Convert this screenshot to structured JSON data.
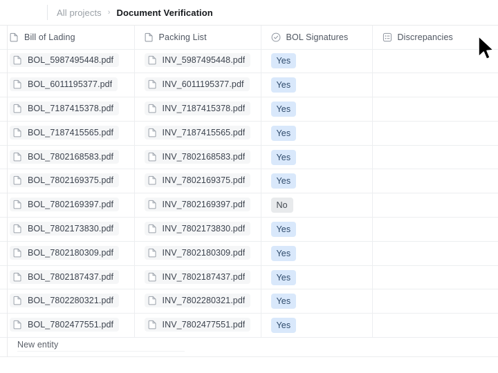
{
  "breadcrumb": {
    "root_label": "All projects",
    "separator": "›",
    "current_label": "Document Verification"
  },
  "table": {
    "columns": [
      {
        "label": "Bill of Lading",
        "icon": "file-icon"
      },
      {
        "label": "Packing List",
        "icon": "file-icon"
      },
      {
        "label": "BOL Signatures",
        "icon": "check-circle-icon"
      },
      {
        "label": "Discrepancies",
        "icon": "select-list-icon"
      }
    ],
    "rows": [
      {
        "bol": "BOL_5987495448.pdf",
        "packing": "INV_5987495448.pdf",
        "signature": "Yes",
        "discrepancies": ""
      },
      {
        "bol": "BOL_6011195377.pdf",
        "packing": "INV_6011195377.pdf",
        "signature": "Yes",
        "discrepancies": ""
      },
      {
        "bol": "BOL_7187415378.pdf",
        "packing": "INV_7187415378.pdf",
        "signature": "Yes",
        "discrepancies": ""
      },
      {
        "bol": "BOL_7187415565.pdf",
        "packing": "INV_7187415565.pdf",
        "signature": "Yes",
        "discrepancies": ""
      },
      {
        "bol": "BOL_7802168583.pdf",
        "packing": "INV_7802168583.pdf",
        "signature": "Yes",
        "discrepancies": ""
      },
      {
        "bol": "BOL_7802169375.pdf",
        "packing": "INV_7802169375.pdf",
        "signature": "Yes",
        "discrepancies": ""
      },
      {
        "bol": "BOL_7802169397.pdf",
        "packing": "INV_7802169397.pdf",
        "signature": "No",
        "discrepancies": ""
      },
      {
        "bol": "BOL_7802173830.pdf",
        "packing": "INV_7802173830.pdf",
        "signature": "Yes",
        "discrepancies": ""
      },
      {
        "bol": "BOL_7802180309.pdf",
        "packing": "INV_7802180309.pdf",
        "signature": "Yes",
        "discrepancies": ""
      },
      {
        "bol": "BOL_7802187437.pdf",
        "packing": "INV_7802187437.pdf",
        "signature": "Yes",
        "discrepancies": ""
      },
      {
        "bol": "BOL_7802280321.pdf",
        "packing": "INV_7802280321.pdf",
        "signature": "Yes",
        "discrepancies": ""
      },
      {
        "bol": "BOL_7802477551.pdf",
        "packing": "INV_7802477551.pdf",
        "signature": "Yes",
        "discrepancies": ""
      }
    ],
    "new_entity_label": "New entity"
  },
  "colors": {
    "badge_yes_bg": "#d9e8fb",
    "badge_yes_text": "#2e4a6b",
    "badge_no_bg": "#e8eaec",
    "badge_no_text": "#41474f",
    "chip_bg": "#f5f6f7",
    "grid_line": "#eceef0"
  },
  "cursor": {
    "type": "arrow-pointer"
  }
}
